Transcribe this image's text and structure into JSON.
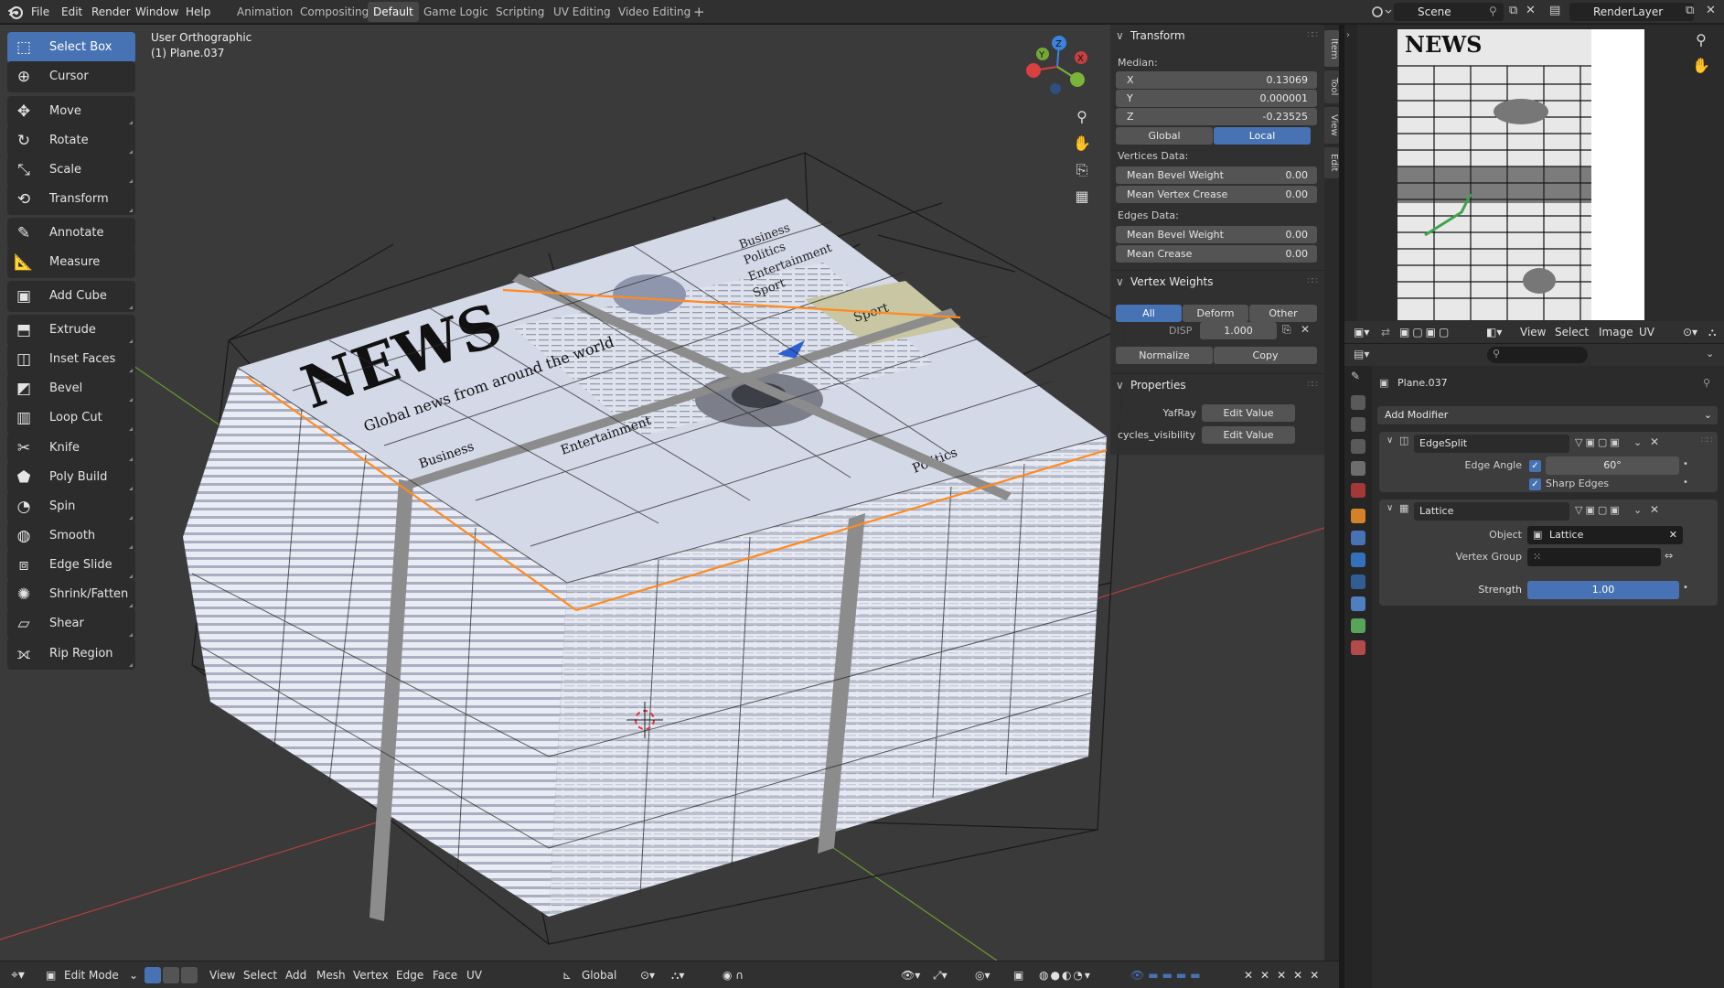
{
  "topbar": {
    "menus": [
      "File",
      "Edit",
      "Render",
      "Window",
      "Help"
    ],
    "workspaces": [
      "Animation",
      "Compositing",
      "Default",
      "Game Logic",
      "Scripting",
      "UV Editing",
      "Video Editing"
    ],
    "active_workspace": "Default",
    "add_tab": "+",
    "scene": "Scene",
    "render_layer": "RenderLayer"
  },
  "viewport": {
    "view_name": "User Orthographic",
    "object_name": "(1) Plane.037",
    "newspaper": {
      "masthead": "NEWS",
      "tagline": "Global news from around the world",
      "sections": [
        "Business",
        "Entertainment",
        "Politics",
        "Sport"
      ],
      "header_links": [
        "Business",
        "Politics",
        "Entertainment",
        "Sport"
      ]
    }
  },
  "toolbar": {
    "tools": [
      {
        "label": "Select Box",
        "icon": "select-box-icon",
        "active": true
      },
      {
        "label": "Cursor",
        "icon": "cursor-icon"
      },
      {
        "label": "Move",
        "icon": "move-icon"
      },
      {
        "label": "Rotate",
        "icon": "rotate-icon"
      },
      {
        "label": "Scale",
        "icon": "scale-icon"
      },
      {
        "label": "Transform",
        "icon": "transform-icon"
      },
      {
        "label": "Annotate",
        "icon": "annotate-icon"
      },
      {
        "label": "Measure",
        "icon": "measure-icon"
      },
      {
        "label": "Add Cube",
        "icon": "add-cube-icon"
      },
      {
        "label": "Extrude Region",
        "icon": "extrude-icon"
      },
      {
        "label": "Inset Faces",
        "icon": "inset-icon"
      },
      {
        "label": "Bevel",
        "icon": "bevel-icon"
      },
      {
        "label": "Loop Cut",
        "icon": "loop-cut-icon"
      },
      {
        "label": "Knife",
        "icon": "knife-icon"
      },
      {
        "label": "Poly Build",
        "icon": "poly-build-icon"
      },
      {
        "label": "Spin",
        "icon": "spin-icon"
      },
      {
        "label": "Smooth",
        "icon": "smooth-icon"
      },
      {
        "label": "Edge Slide",
        "icon": "edge-slide-icon"
      },
      {
        "label": "Shrink/Fatten",
        "icon": "shrink-fatten-icon"
      },
      {
        "label": "Shear",
        "icon": "shear-icon"
      },
      {
        "label": "Rip Region",
        "icon": "rip-icon"
      }
    ]
  },
  "npanel": {
    "tabs": [
      "Item",
      "Tool",
      "View",
      "Edit"
    ],
    "transform": {
      "title": "Transform",
      "median_label": "Median:",
      "x_label": "X",
      "x": "0.13069",
      "y_label": "Y",
      "y": "0.000001",
      "z_label": "Z",
      "z": "-0.23525",
      "global": "Global",
      "local": "Local",
      "vertices_data": "Vertices Data:",
      "mean_bevel_weight_label": "Mean Bevel Weight",
      "mean_bevel_weight": "0.00",
      "mean_vertex_crease_label": "Mean Vertex Crease",
      "mean_vertex_crease": "0.00",
      "edges_data": "Edges Data:",
      "edge_bevel_weight_label": "Mean Bevel Weight",
      "edge_bevel_weight": "0.00",
      "mean_crease_label": "Mean Crease",
      "mean_crease": "0.00"
    },
    "vertex_weights": {
      "title": "Vertex Weights",
      "all": "All",
      "deform": "Deform",
      "other": "Other",
      "disp_label": "DISP",
      "disp_value": "1.000",
      "normalize": "Normalize",
      "copy": "Copy"
    },
    "properties": {
      "title": "Properties",
      "yafray_label": "YafRay",
      "yafray_btn": "Edit Value",
      "cycles_label": "cycles_visibility",
      "cycles_btn": "Edit Value"
    }
  },
  "bottombar": {
    "mode": "Edit Mode",
    "menus": [
      "View",
      "Select",
      "Add",
      "Mesh",
      "Vertex",
      "Edge",
      "Face",
      "UV"
    ],
    "orientation": "Global"
  },
  "image_editor": {
    "menus": [
      "View",
      "Select",
      "Image",
      "UV"
    ]
  },
  "properties_editor": {
    "object": "Plane.037",
    "add_modifier": "Add Modifier",
    "modifiers": [
      {
        "name": "EdgeSplit",
        "edge_angle_label": "Edge Angle",
        "edge_angle": "60°",
        "sharp_edges_label": "Sharp Edges"
      },
      {
        "name": "Lattice",
        "object_label": "Object",
        "object_value": "Lattice",
        "vertex_group_label": "Vertex Group",
        "vertex_group_value": "",
        "strength_label": "Strength",
        "strength": "1.00"
      }
    ]
  },
  "colors": {
    "accent": "#4772b3",
    "viewport_bg": "#3a3a3a",
    "panel_bg": "#303030",
    "x_axis": "#d6403f",
    "y_axis": "#7ab539",
    "z_axis": "#3a83e0",
    "selected_edge": "#ff8a20"
  }
}
